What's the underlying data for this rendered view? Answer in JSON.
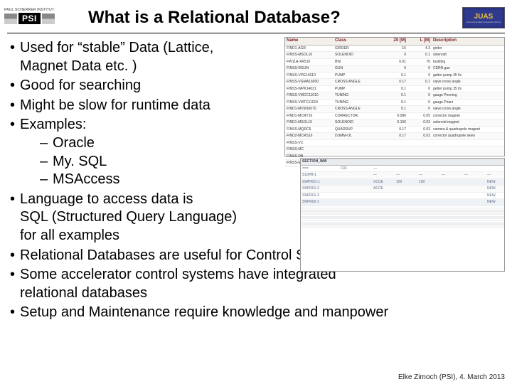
{
  "header": {
    "psi_tag": "PAUL SCHERRER INSTITUT",
    "psi_text": "PSI",
    "title": "What is a Relational Database?",
    "juas_text": "JUAS",
    "juas_sub": "Joint Universities Accelerator School"
  },
  "bullets": [
    "Used for “stable” Data (Lattice, Magnet Data etc. )",
    "Good for searching",
    "Might be slow for runtime data",
    "Examples:",
    "Language to access data is SQL (Structured Query Language) for all examples",
    "Relational Databases are useful for Control Systems",
    "Some accelerator control systems have integrated relational databases",
    "Setup and Maintenance require knowledge and manpower"
  ],
  "examples": [
    "Oracle",
    "My. SQL",
    "MSAccess"
  ],
  "footer": "Elke Zimoch (PSI), 4. March 2013",
  "table1": {
    "headers": [
      "Name",
      "Class",
      "Z0 [M]",
      "L [M]",
      "Description"
    ],
    "rows": [
      [
        "FIND1-AGR",
        "GIRDER",
        "-15",
        "4.3",
        "girder"
      ],
      [
        "FINSS-MSOL10",
        "SOLENOID",
        "0",
        "0.1",
        "solenoid"
      ],
      [
        "FW11A-XR510",
        "BW",
        "0.01",
        "70",
        "building"
      ],
      [
        "FINSS-RGUN",
        "GUN",
        "0",
        "0",
        "CERN gun"
      ],
      [
        "FINSS-VPG14010",
        "PUMP",
        "0.1",
        "0",
        "getter pump 35 l/s"
      ],
      [
        "FINSS-VGMA16000",
        "CROSS ANGLE",
        "0.17",
        "0.1",
        "valve cross angle"
      ],
      [
        "FINSS-WPK14021",
        "PUMP",
        "0.1",
        "0",
        "getter pump 35 l/s"
      ],
      [
        "FINSS-VMCC11010",
        "TUNING",
        "0.1",
        "0",
        "gauge Penning"
      ],
      [
        "FINSS-VMTC11010",
        "TUNING",
        "0.1",
        "0",
        "gauge Pirani"
      ],
      [
        "FIND1-MVM16070",
        "CROSS ANGLE",
        "0.1",
        "0",
        "valve cross angle"
      ],
      [
        "FIND1-MCRY10",
        "CORRECTOR",
        "0.086",
        "0.05",
        "corrector magnet"
      ],
      [
        "FIND1-MSOL10",
        "SOLENOID",
        "0.166",
        "0.03",
        "solenoid magnet"
      ],
      [
        "FINSS-MQRC5",
        "QUADRUP",
        "0.17",
        "0.03",
        "camera & quadrupole magnet"
      ],
      [
        "FIND2-MCRS16",
        "DUMM-OL",
        "0.17",
        "0.03",
        "corrector quadrupole skew"
      ],
      [
        "FINSS-VC",
        "",
        "",
        "",
        ""
      ],
      [
        "FINSS-MC",
        "",
        "",
        "",
        ""
      ],
      [
        "FINSS-DB",
        "",
        "",
        "",
        ""
      ],
      [
        "FINSS-MC",
        "",
        "",
        "",
        ""
      ]
    ]
  },
  "table2": {
    "headers": [
      "SECTION_WW",
      "",
      "",
      "",
      "",
      "",
      "",
      ""
    ],
    "rows": [
      [
        "===",
        "C01",
        "—",
        "",
        "",
        "",
        "",
        ""
      ],
      [
        "S10PB-1",
        "",
        "—",
        "—",
        "—",
        "—",
        "—",
        "—"
      ],
      [
        "SWPR01-1",
        "",
        "XCCE",
        "100",
        "100",
        "",
        "",
        "NEW"
      ],
      [
        "SNPR01-2",
        "",
        "ACCE",
        "",
        "",
        "",
        "",
        "NEW"
      ],
      [
        "SNPR01-3",
        "",
        "",
        "",
        "",
        "",
        "",
        "NEW"
      ],
      [
        "SNPR02-1",
        "",
        "",
        "",
        "",
        "",
        "",
        "NEW"
      ],
      [
        "",
        "",
        "",
        "",
        "",
        "",
        "",
        ""
      ],
      [
        "",
        "",
        "",
        "",
        "",
        "",
        "",
        ""
      ],
      [
        "",
        "",
        "",
        "",
        "",
        "",
        "",
        ""
      ],
      [
        "",
        "",
        "",
        "",
        "",
        "",
        "",
        ""
      ],
      [
        "",
        "",
        "",
        "",
        "",
        "",
        "",
        ""
      ],
      [
        "",
        "",
        "",
        "",
        "",
        "",
        "",
        ""
      ],
      [
        "",
        "",
        "",
        "",
        "",
        "",
        "",
        ""
      ],
      [
        "",
        "",
        "",
        "",
        "",
        "",
        "",
        ""
      ],
      [
        "",
        "",
        "",
        "",
        "",
        "",
        "",
        ""
      ],
      [
        "",
        "",
        "",
        "",
        "",
        "",
        "",
        ""
      ]
    ]
  }
}
